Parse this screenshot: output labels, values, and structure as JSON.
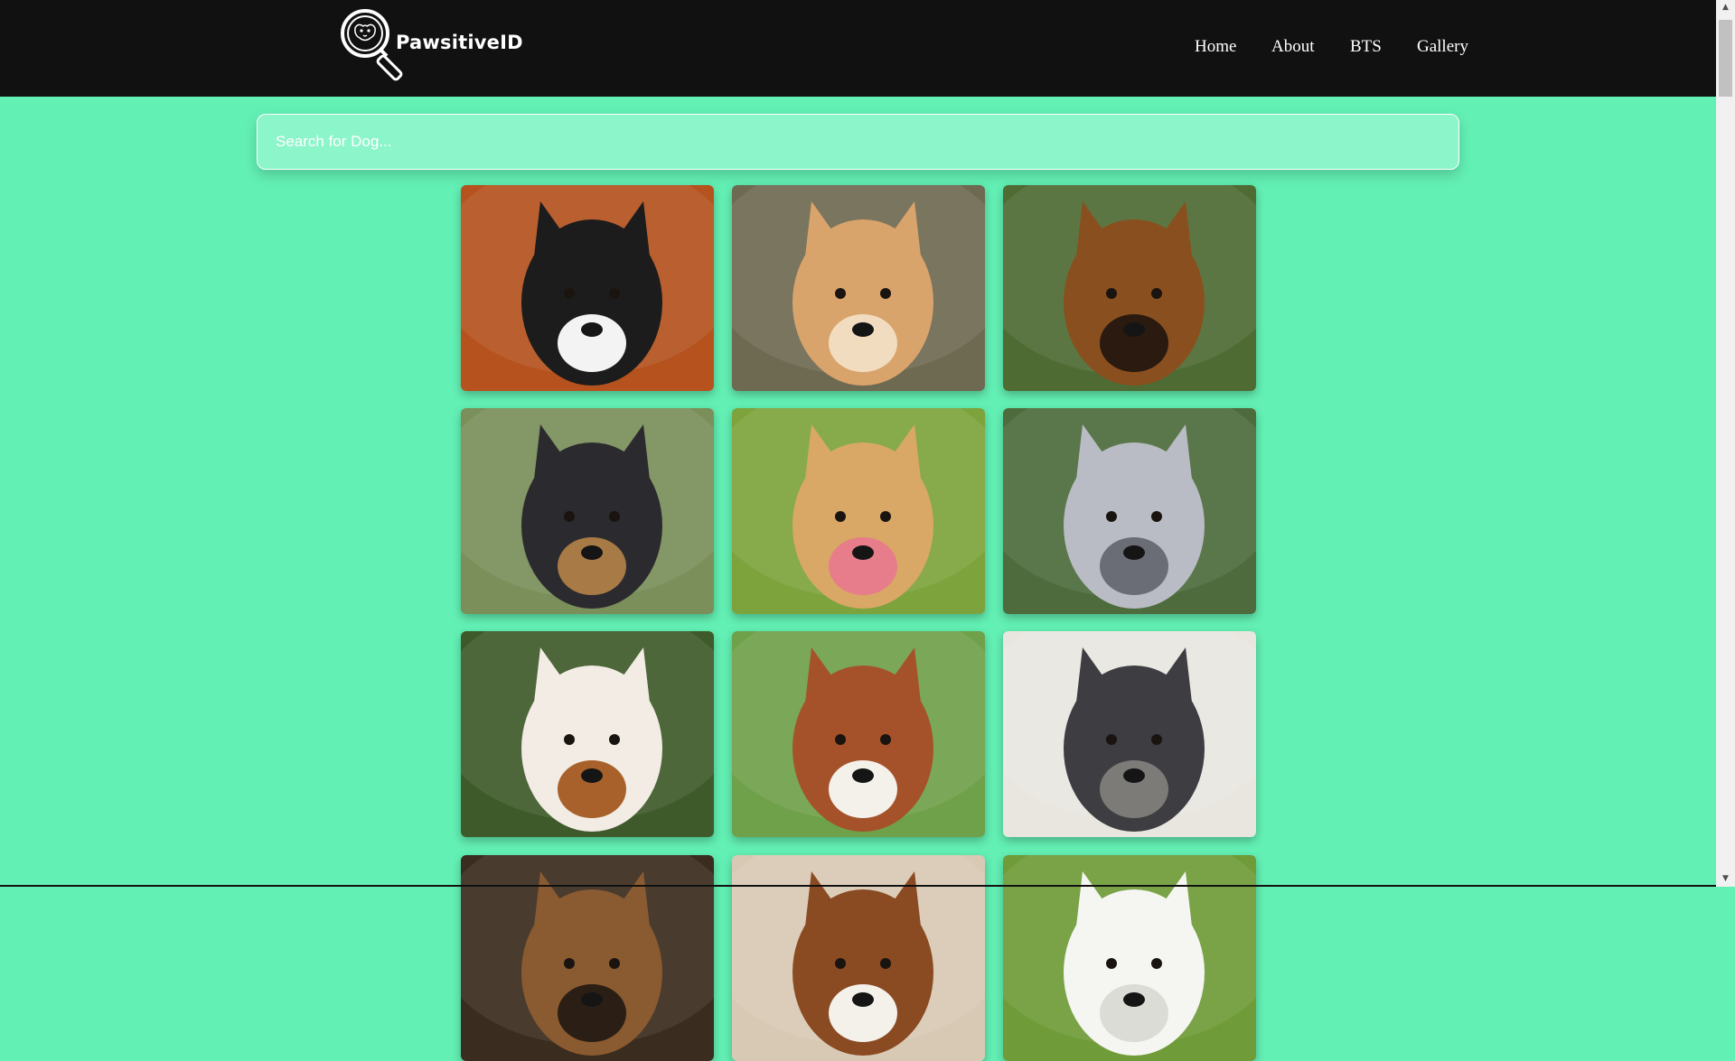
{
  "brand": {
    "name": "PawsitiveID",
    "icon": "magnifier-dog-icon"
  },
  "nav": {
    "items": [
      {
        "label": "Home"
      },
      {
        "label": "About"
      },
      {
        "label": "BTS"
      },
      {
        "label": "Gallery"
      }
    ]
  },
  "search": {
    "placeholder": "Search for Dog...",
    "value": ""
  },
  "gallery": {
    "cards": [
      {
        "subject": "boston-terrier",
        "bg": "#b5521e",
        "fg": "#1c1c1c",
        "accent": "#f3f3f3"
      },
      {
        "subject": "dingo-puppy",
        "bg": "#6e6a52",
        "fg": "#d9a46b",
        "accent": "#f1dcc0"
      },
      {
        "subject": "pekingese",
        "bg": "#4f6b34",
        "fg": "#8a4f1e",
        "accent": "#2a1a10"
      },
      {
        "subject": "bluetick-hound",
        "bg": "#7a8f5a",
        "fg": "#2b2b2f",
        "accent": "#a87a45"
      },
      {
        "subject": "golden-retriever",
        "bg": "#7da33c",
        "fg": "#d9a866",
        "accent": "#e77c8a"
      },
      {
        "subject": "bedlington-terrier",
        "bg": "#4d6b3c",
        "fg": "#b9bcc4",
        "accent": "#6a6d75"
      },
      {
        "subject": "borzoi",
        "bg": "#3e5a2a",
        "fg": "#f2ece4",
        "accent": "#a8612a"
      },
      {
        "subject": "basenji",
        "bg": "#6fa04a",
        "fg": "#a5522a",
        "accent": "#f4f0ea"
      },
      {
        "subject": "scottish-deerhound",
        "bg": "#e9e6e0",
        "fg": "#3e3e42",
        "accent": "#7d7b78"
      },
      {
        "subject": "partial-dog-1",
        "bg": "#3a2c1e",
        "fg": "#8a5a30",
        "accent": "#2b1e14"
      },
      {
        "subject": "partial-dog-2",
        "bg": "#d8c9b5",
        "fg": "#8a4a22",
        "accent": "#f4f0ea"
      },
      {
        "subject": "partial-dog-3",
        "bg": "#6f9b38",
        "fg": "#f5f5f2",
        "accent": "#dcdcd6"
      }
    ]
  },
  "colors": {
    "page_bg": "#63f0b4",
    "navbar_bg": "#111111",
    "search_bg": "#8df5ca"
  }
}
